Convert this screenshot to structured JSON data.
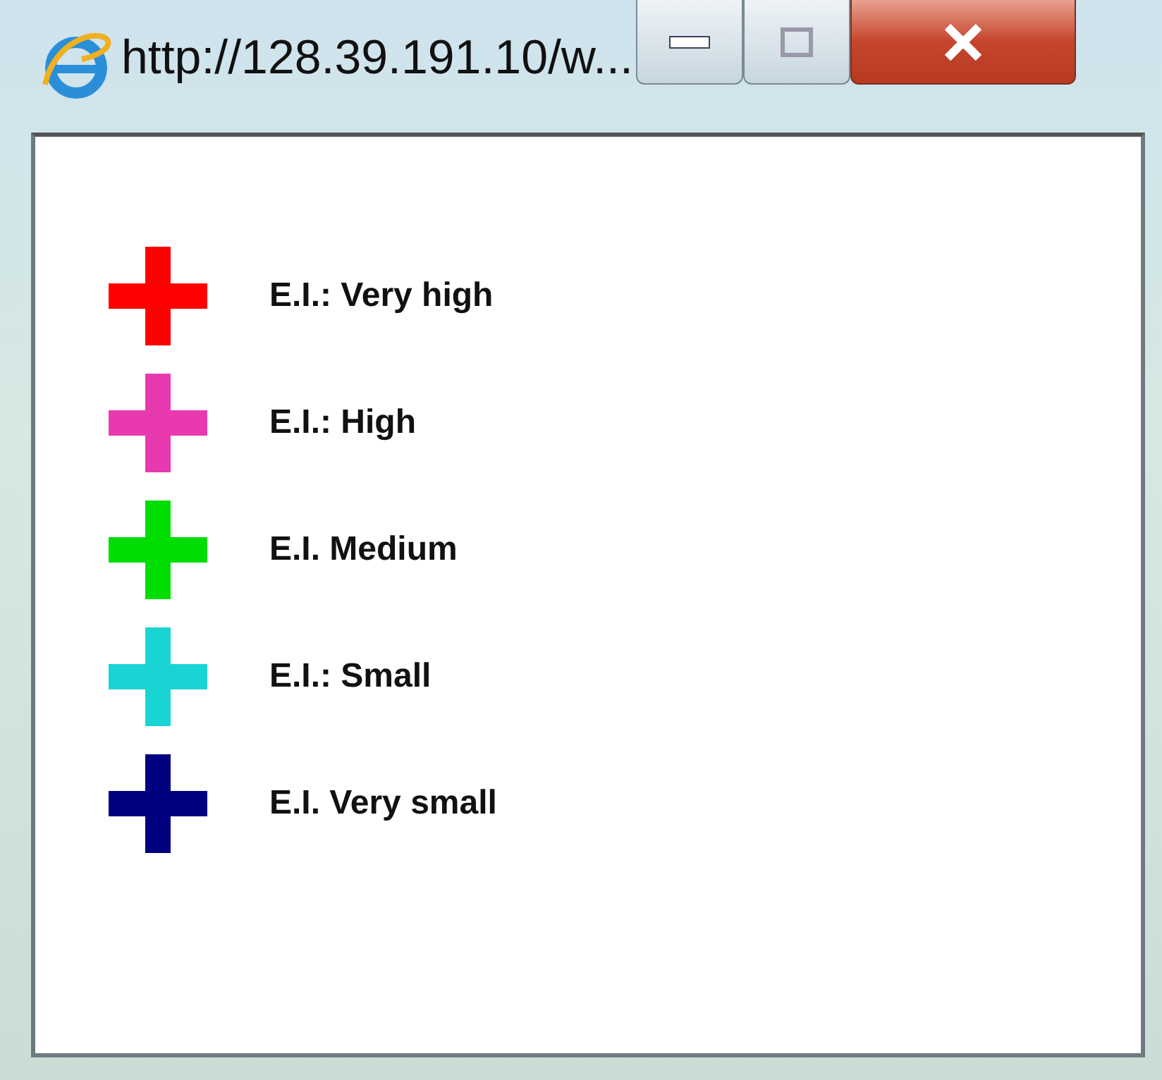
{
  "window": {
    "title": "http://128.39.191.10/w..."
  },
  "legend": [
    {
      "label": "E.I.: Very high",
      "color": "#ff0000"
    },
    {
      "label": "E.I.: High",
      "color": "#e83aae"
    },
    {
      "label": "E.I. Medium",
      "color": "#00dd00"
    },
    {
      "label": "E.I.: Small",
      "color": "#1ad4d4"
    },
    {
      "label": "E.I. Very small",
      "color": "#000080"
    }
  ]
}
